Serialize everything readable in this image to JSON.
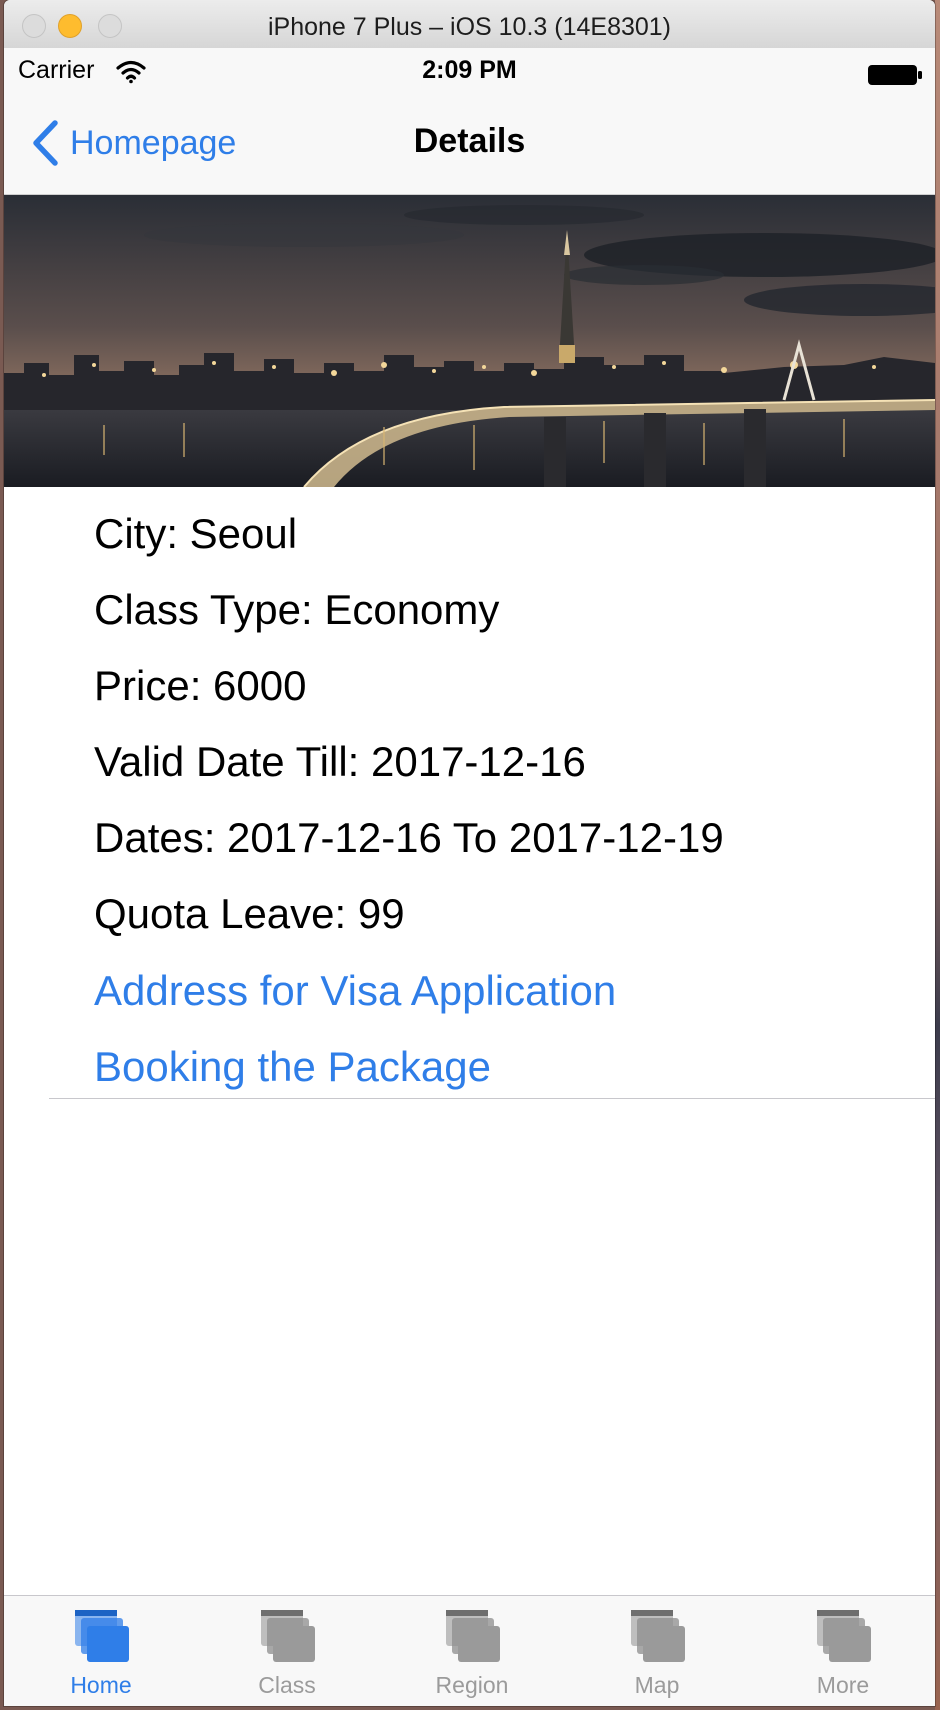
{
  "window": {
    "title": "iPhone 7 Plus – iOS 10.3 (14E8301)"
  },
  "status_bar": {
    "carrier": "Carrier",
    "time": "2:09 PM",
    "icons": [
      "wifi-icon",
      "battery-icon"
    ]
  },
  "nav_bar": {
    "back_label": "Homepage",
    "title": "Details",
    "back_icon": "chevron-left-icon"
  },
  "hero_image": {
    "description_icon": "city-skyline-photo"
  },
  "details": {
    "city": "City: Seoul",
    "class_type": "Class Type: Economy",
    "price": "Price: 6000",
    "valid_date": "Valid Date Till: 2017-12-16",
    "dates": "Dates: 2017-12-16 To 2017-12-19",
    "quota": "Quota Leave: 99",
    "visa_link": "Address for Visa Application",
    "booking_link": "Booking the Package"
  },
  "tab_bar": {
    "tabs": [
      {
        "label": "Home",
        "active": true
      },
      {
        "label": "Class",
        "active": false
      },
      {
        "label": "Region",
        "active": false
      },
      {
        "label": "Map",
        "active": false
      },
      {
        "label": "More",
        "active": false
      }
    ]
  },
  "colors": {
    "accent": "#2f7ee8",
    "inactive_tab": "#9b9b9b",
    "bar_bg": "#f8f8f8"
  }
}
